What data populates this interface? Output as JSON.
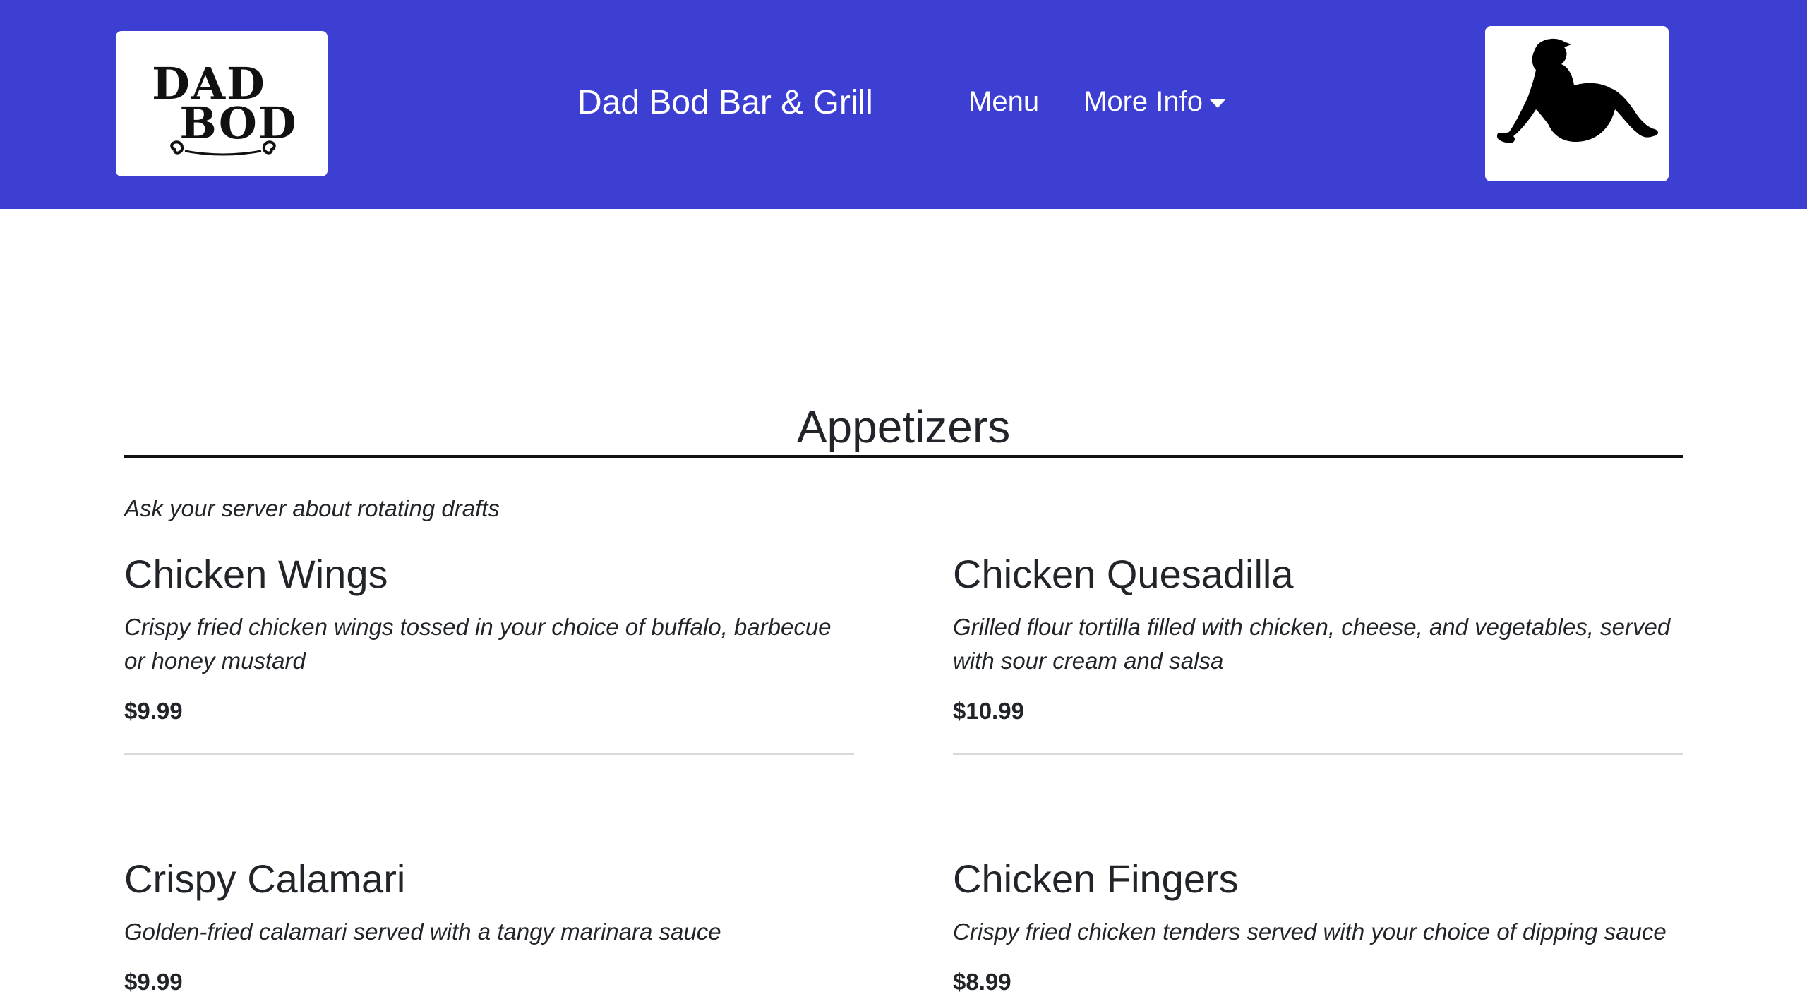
{
  "header": {
    "logo_text_line1": "DAD",
    "logo_text_line2": "BOD",
    "brand": "Dad Bod Bar & Grill",
    "nav": {
      "menu_label": "Menu",
      "more_info_label": "More Info"
    },
    "bg_color": "#3d3fd3"
  },
  "main": {
    "section_title": "Appetizers",
    "note": "Ask your server about rotating drafts",
    "items": [
      {
        "name": "Chicken Wings",
        "description": "Crispy fried chicken wings tossed in your choice of buffalo, barbecue or honey mustard",
        "price": "$9.99"
      },
      {
        "name": "Chicken Quesadilla",
        "description": "Grilled flour tortilla filled with chicken, cheese, and vegetables, served with sour cream and salsa",
        "price": "$10.99"
      },
      {
        "name": "Crispy Calamari",
        "description": "Golden-fried calamari served with a tangy marinara sauce",
        "price": "$9.99"
      },
      {
        "name": "Chicken Fingers",
        "description": "Crispy fried chicken tenders served with your choice of dipping sauce",
        "price": "$8.99"
      }
    ]
  }
}
